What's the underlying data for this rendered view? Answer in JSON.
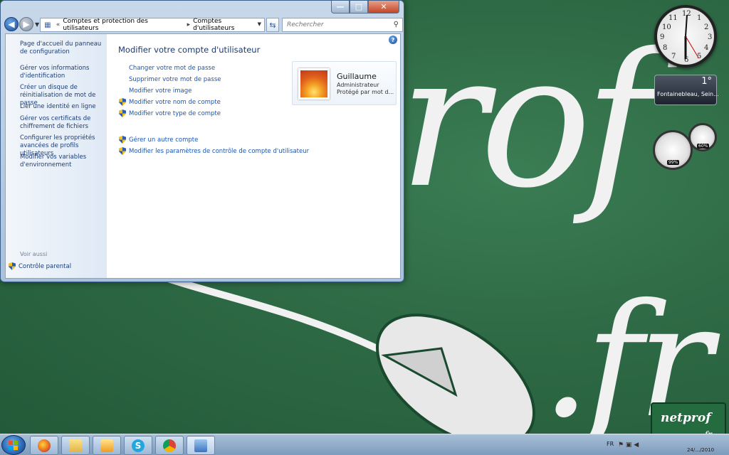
{
  "window": {
    "caption_buttons": {
      "minimize": "—",
      "maximize": "□",
      "close": "✕"
    },
    "breadcrumb": {
      "overflow": "«",
      "items": [
        "Comptes et protection des utilisateurs",
        "Comptes d'utilisateurs"
      ],
      "separator": "▸"
    },
    "search_placeholder": "Rechercher",
    "left_pane": {
      "links": [
        "Page d'accueil du panneau de configuration",
        "Gérer vos informations d'identification",
        "Créer un disque de réinitialisation de mot de passe",
        "Lier une identité en ligne",
        "Gérer vos certificats de chiffrement de fichiers",
        "Configurer les propriétés avancées de profils utilisateurs",
        "Modifier vos variables d'environnement"
      ],
      "see_also": "Voir aussi",
      "parental_control": "Contrôle parental"
    },
    "main": {
      "title": "Modifier votre compte d'utilisateur",
      "tasks": [
        "Changer votre mot de passe",
        "Supprimer votre mot de passe",
        "Modifier votre image",
        "Modifier votre nom de compte",
        "Modifier votre type de compte"
      ],
      "other_tasks": [
        "Gérer un autre compte",
        "Modifier les paramètres de contrôle de compte d'utilisateur"
      ]
    },
    "user": {
      "name": "Guillaume",
      "role": "Administrateur",
      "password_status": "Protégé par mot d..."
    }
  },
  "gadgets": {
    "clock_numbers": [
      "12",
      "1",
      "2",
      "3",
      "4",
      "5",
      "6",
      "7",
      "8",
      "9",
      "10",
      "11"
    ],
    "weather": {
      "temp": "1°",
      "city": "Fontainebleau, Sein..."
    },
    "meter": {
      "cpu": "99%",
      "ram": "60%"
    }
  },
  "wallpaper": {
    "word1": "rof",
    "word2": ".fr"
  },
  "watermark": {
    "brand": "netprof",
    "tld": ".fr"
  },
  "taskbar": {
    "apps": [
      "firefox",
      "explorer",
      "media-player",
      "skype",
      "chrome",
      "control-panel"
    ],
    "lang": "FR",
    "date": "24/.../2010"
  }
}
